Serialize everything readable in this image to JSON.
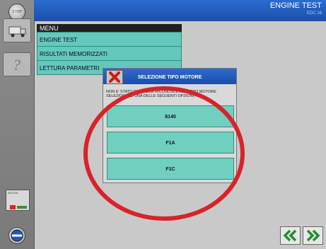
{
  "header": {
    "title": "ENGINE TEST",
    "subtitle": "EDC 16"
  },
  "sidebar": {
    "stop_label": "STOP",
    "indicator_label": "NO EOL"
  },
  "menu": {
    "header": "MENU",
    "items": [
      {
        "label": "ENGINE TEST"
      },
      {
        "label": "RISULTATI MEMORIZZATI"
      },
      {
        "label": "LETTURA PARAMETRI"
      }
    ]
  },
  "dialog": {
    "title": "SELEZIONE TIPO MOTORE",
    "message_line1": "NON E' STATO POSSIBILE RICONOSCERE IL TIPO MOTORE",
    "message_line2": "SELEZIONARE UNA DELLE SEGUENTI OPZIONI.",
    "options": [
      {
        "label": "8140"
      },
      {
        "label": "F1A"
      },
      {
        "label": "F1C"
      }
    ]
  },
  "colors": {
    "accent_blue": "#1f57b5",
    "menu_teal": "#63c9ba",
    "annotation_red": "#d8232a"
  },
  "icons": [
    "stop-icon",
    "truck-icon",
    "help-icon",
    "power-icon",
    "close-icon",
    "back-double-icon",
    "forward-double-icon"
  ]
}
